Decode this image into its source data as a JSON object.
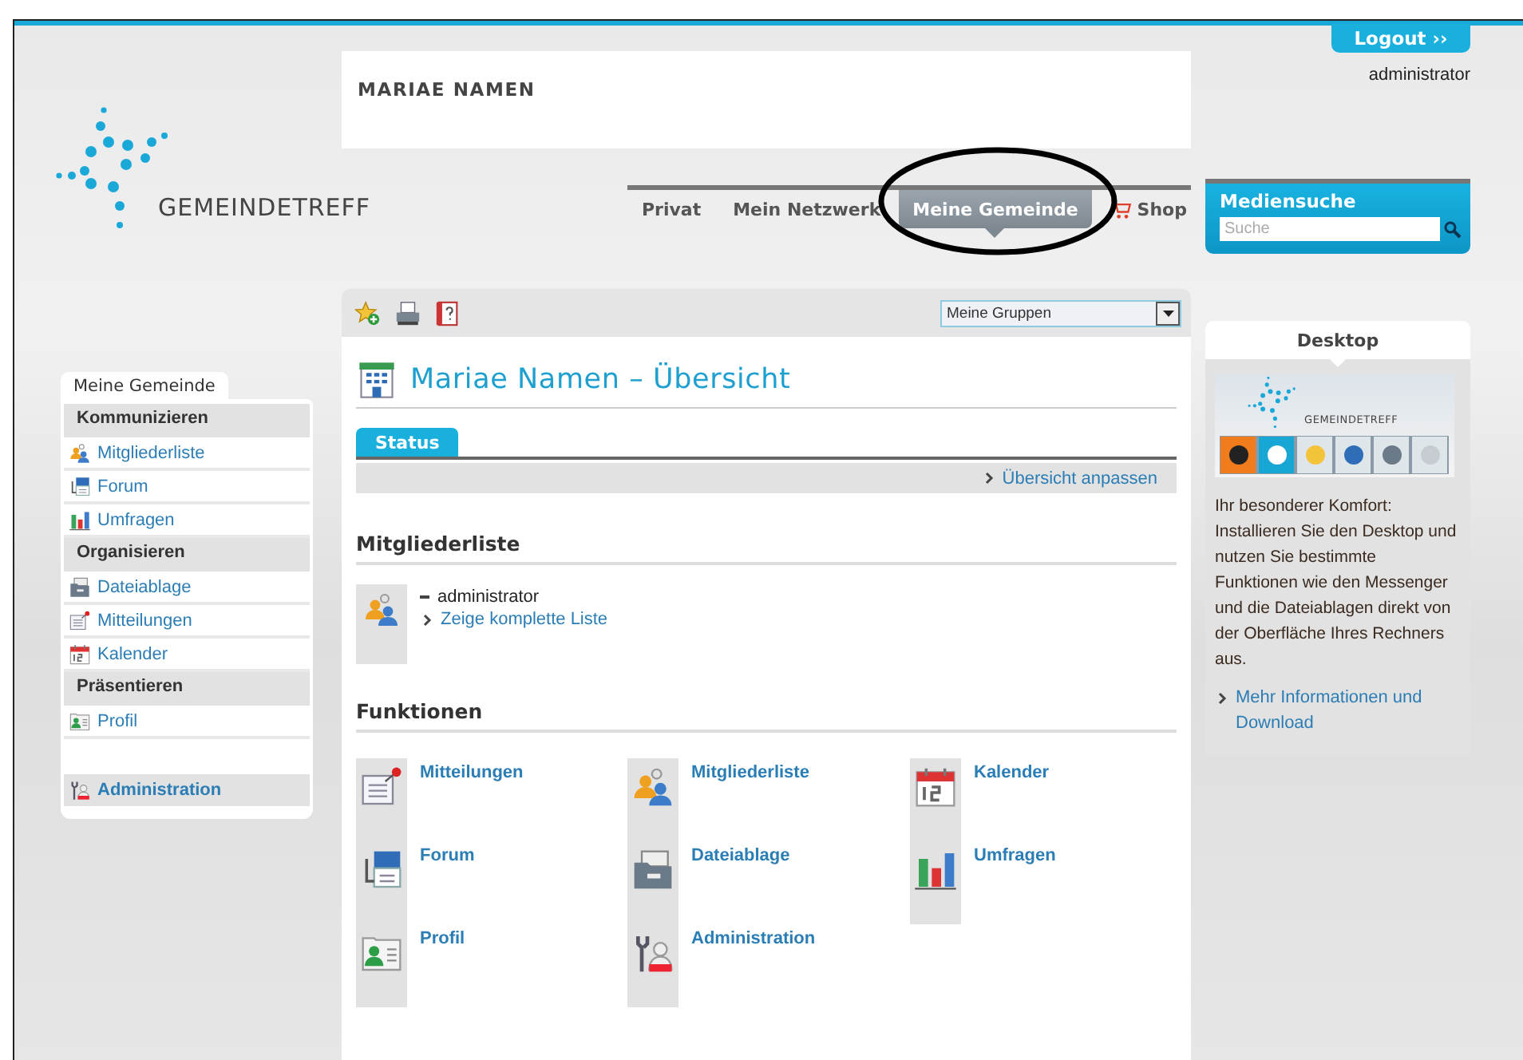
{
  "header": {
    "site_name": "MARIAE NAMEN",
    "logo_text": "GEMEINDETREFF",
    "logout": "Logout ››",
    "user": "administrator"
  },
  "nav": [
    {
      "label": "Privat",
      "selected": false
    },
    {
      "label": "Mein Netzwerk",
      "selected": false
    },
    {
      "label": "Meine Gemeinde",
      "selected": true
    },
    {
      "label": "Shop",
      "selected": false
    }
  ],
  "media_search": {
    "title": "Mediensuche",
    "placeholder": "Suche"
  },
  "toolbar": {
    "group_select": "Meine Gruppen"
  },
  "page_title": "Mariae Namen – Übersicht",
  "tabs": [
    {
      "label": "Status",
      "selected": true
    }
  ],
  "customize_link": "Übersicht anpassen",
  "members": {
    "heading": "Mitgliederliste",
    "items": [
      "administrator"
    ],
    "link": "Zeige komplette Liste"
  },
  "functions": {
    "heading": "Funktionen",
    "items": [
      "Mitteilungen",
      "Mitgliederliste",
      "Kalender",
      "Forum",
      "Dateiablage",
      "Umfragen",
      "Profil",
      "Administration"
    ]
  },
  "sidebar": {
    "tab": "Meine Gemeinde",
    "groups": [
      {
        "title": "Kommunizieren",
        "items": [
          "Mitgliederliste",
          "Forum",
          "Umfragen"
        ]
      },
      {
        "title": "Organisieren",
        "items": [
          "Dateiablage",
          "Mitteilungen",
          "Kalender"
        ]
      },
      {
        "title": "Präsentieren",
        "items": [
          "Profil"
        ]
      }
    ],
    "admin": "Administration"
  },
  "desktop": {
    "title": "Desktop",
    "banner_logo": "GEMEINDETREFF",
    "text": "Ihr besonderer Komfort: Installieren Sie den Desktop und nutzen Sie bestimmte Funktionen wie den Messenger und die Dateiablagen direkt von der Oberfläche Ihres Rechners aus.",
    "link": "Mehr Informationen und Download"
  }
}
